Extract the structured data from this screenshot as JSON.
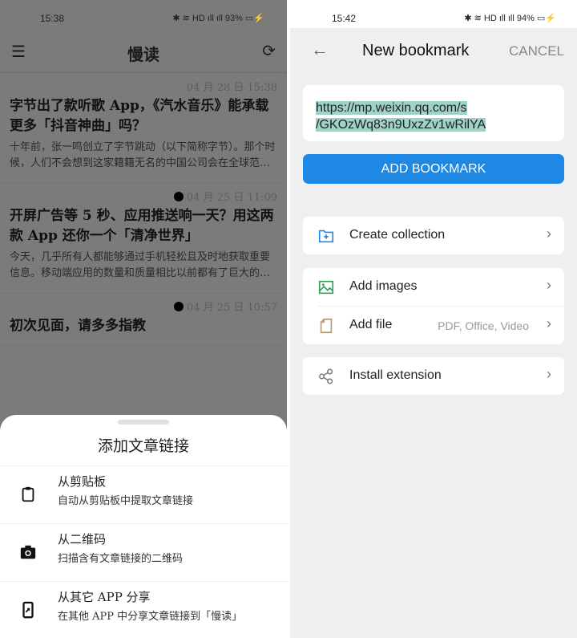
{
  "left": {
    "status": {
      "time": "15:38",
      "icons": "✱ ≋ HD ıll ıll 93% ▭⚡"
    },
    "appbar": {
      "title": "慢读",
      "menu_icon": "hamburger-icon",
      "refresh_icon": "sync-icon"
    },
    "articles": [
      {
        "date": "04 月 28 日 15:38",
        "unread": false,
        "title": "字节出了款听歌 App，《汽水音乐》能承载更多「抖音神曲」吗？",
        "summary": "十年前，张一鸣创立了字节跳动（以下简称字节）。那个时候，人们不会想到这家籍籍无名的中国公司会在全球范围内掀起风潮"
      },
      {
        "date": "04 月 25 日 11:09",
        "unread": true,
        "title": "开屏广告等 5 秒、应用推送响一天？用这两款 App 还你一个「清净世界」",
        "summary": "今天，几乎所有人都能够通过手机轻松且及时地获取重要信息。移动端应用的数量和质量相比以前都有了巨大的提升"
      },
      {
        "date": "04 月 25 日 10:57",
        "unread": true,
        "title": "初次见面，请多多指教",
        "summary": ""
      }
    ],
    "sheet": {
      "title": "添加文章链接",
      "options": [
        {
          "icon": "clipboard-icon",
          "label": "从剪贴板",
          "desc": "自动从剪贴板中提取文章链接"
        },
        {
          "icon": "camera-icon",
          "label": "从二维码",
          "desc": "扫描含有文章链接的二维码"
        },
        {
          "icon": "phone-share-icon",
          "label": "从其它 APP 分享",
          "desc": "在其他 APP 中分享文章链接到「慢读」"
        }
      ]
    }
  },
  "right": {
    "status": {
      "time": "15:42",
      "icons": "✱ ≋ HD ıll ıll 94% ▭⚡"
    },
    "header": {
      "title": "New bookmark",
      "cancel": "CANCEL"
    },
    "url": {
      "line1": "https://mp.weixin.qq.com/s",
      "line2": "/GKOzWq83n9UxzZv1wRilYA"
    },
    "add_button": "ADD BOOKMARK",
    "rows": {
      "create_collection": "Create collection",
      "add_images": "Add images",
      "add_file": "Add file",
      "add_file_hint": "PDF, Office, Video",
      "install_extension": "Install extension"
    },
    "colors": {
      "accent": "#1e88e5",
      "selection": "#9fd3c9"
    }
  }
}
